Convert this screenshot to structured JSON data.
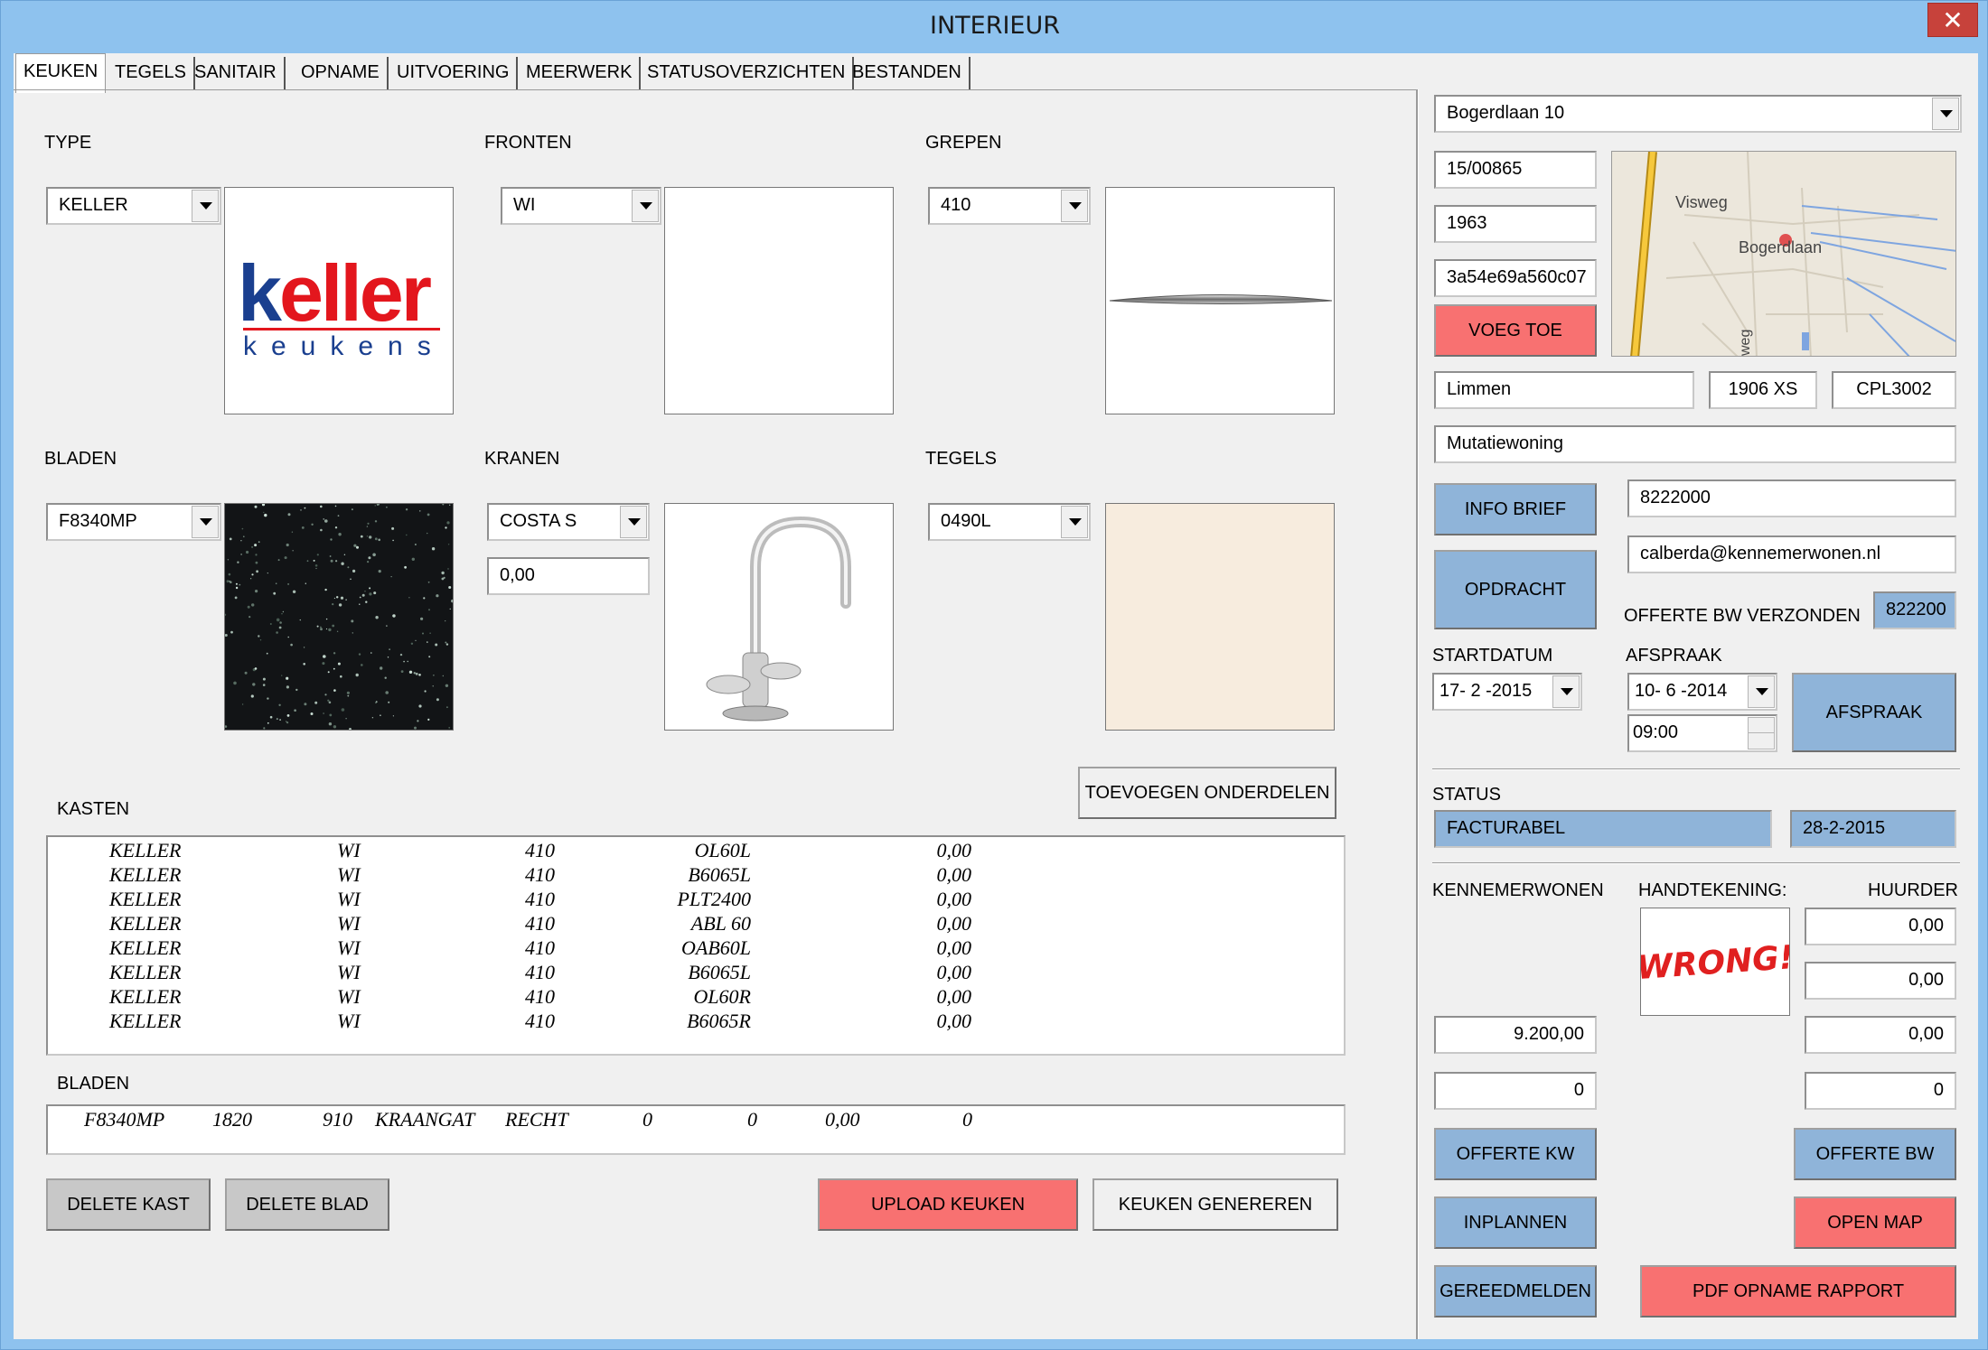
{
  "window": {
    "title": "INTERIEUR",
    "close_glyph": "✕"
  },
  "tabs": [
    "KEUKEN",
    "TEGELS",
    "SANITAIR",
    "OPNAME",
    "UITVOERING",
    "MEERWERK",
    "STATUSOVERZICHTEN",
    "BESTANDEN"
  ],
  "keuken": {
    "type": {
      "label": "TYPE",
      "value": "KELLER"
    },
    "fronten": {
      "label": "FRONTEN",
      "value": "WI"
    },
    "grepen": {
      "label": "GREPEN",
      "value": "410"
    },
    "bladen": {
      "label": "BLADEN",
      "value": "F8340MP"
    },
    "kranen": {
      "label": "KRANEN",
      "value": "COSTA S",
      "price": "0,00"
    },
    "tegels": {
      "label": "TEGELS",
      "value": "0490L"
    },
    "logo": {
      "brand": "keller",
      "sub": "keukens"
    },
    "kasten_label": "KASTEN",
    "kasten_rows": [
      [
        "KELLER",
        "WI",
        "410",
        "OL60L",
        "0,00"
      ],
      [
        "KELLER",
        "WI",
        "410",
        "B6065L",
        "0,00"
      ],
      [
        "KELLER",
        "WI",
        "410",
        "PLT2400",
        "0,00"
      ],
      [
        "KELLER",
        "WI",
        "410",
        "ABL 60",
        "0,00"
      ],
      [
        "KELLER",
        "WI",
        "410",
        "OAB60L",
        "0,00"
      ],
      [
        "KELLER",
        "WI",
        "410",
        "B6065L",
        "0,00"
      ],
      [
        "KELLER",
        "WI",
        "410",
        "OL60R",
        "0,00"
      ],
      [
        "KELLER",
        "WI",
        "410",
        "B6065R",
        "0,00"
      ]
    ],
    "bladen_list_label": "BLADEN",
    "bladen_rows": [
      [
        "F8340MP",
        "1820",
        "910",
        "KRAANGAT",
        "RECHT",
        "0",
        "0",
        "0,00",
        "0"
      ]
    ],
    "buttons": {
      "toevoegen": "TOEVOEGEN ONDERDELEN",
      "delete_kast": "DELETE KAST",
      "delete_blad": "DELETE BLAD",
      "upload": "UPLOAD KEUKEN",
      "genereren": "KEUKEN GENEREREN"
    }
  },
  "side": {
    "address": "Bogerdlaan 10",
    "code1": "15/00865",
    "year": "1963",
    "hash": "3a54e69a560c07",
    "voeg_toe": "VOEG TOE",
    "map": {
      "road1": "Visweg",
      "road2": "Bogerdlaan",
      "road3": "weg"
    },
    "city": "Limmen",
    "postcode": "1906 XS",
    "cpl": "CPL3002",
    "woning": "Mutatiewoning",
    "info_brief": "INFO BRIEF",
    "opdracht": "OPDRACHT",
    "phone": "8222000",
    "email": "calberda@kennemerwonen.nl",
    "offerte_bw_verzonden": "OFFERTE BW VERZONDEN",
    "offerte_bw_val": "822200",
    "startdatum_label": "STARTDATUM",
    "startdatum": "17- 2 -2015",
    "afspraak_label": "AFSPRAAK",
    "afspraak_date": "10- 6 -2014",
    "afspraak_time": "09:00",
    "afspraak_btn": "AFSPRAAK",
    "status_label": "STATUS",
    "status": "FACTURABEL",
    "status_date": "28-2-2015",
    "kennemerwonen": "KENNEMERWONEN",
    "handtekening": "HANDTEKENING:",
    "signature_text": "WRONG!",
    "huurder": "HUURDER",
    "huurder_val1": "0,00",
    "huurder_val2": "0,00",
    "huurder_val3": "0,00",
    "huurder_val4": "0",
    "kw_val1": "9.200,00",
    "kw_val2": "0",
    "offerte_kw": "OFFERTE KW",
    "offerte_bw": "OFFERTE BW",
    "inplannen": "INPLANNEN",
    "open_map": "OPEN MAP",
    "gereedmelden": "GEREEDMELDEN",
    "pdf_rapport": "PDF OPNAME RAPPORT"
  },
  "colors": {
    "titlebar": "#8ec2ee",
    "pink": "#f87171",
    "blue": "#8fb4d9",
    "close": "#c7423b"
  }
}
